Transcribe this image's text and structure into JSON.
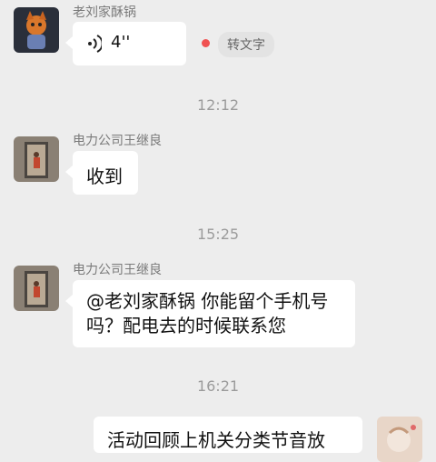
{
  "messages": [
    {
      "sender": "老刘家酥锅",
      "voice_duration": "4''",
      "convert_label": "转文字"
    },
    {
      "timestamp": "12:12",
      "sender": "电力公司王继良",
      "text": "收到"
    },
    {
      "timestamp": "15:25",
      "sender": "电力公司王继良",
      "text_line1": "@老刘家酥锅 你能留个手机号",
      "text_line2": "吗？配电去的时候联系您"
    },
    {
      "timestamp": "16:21",
      "text": "活动回顾上机关分类节音放"
    }
  ],
  "colors": {
    "background": "#ededed",
    "bubble": "#ffffff",
    "unread_dot": "#f05151",
    "meta_text": "#9b9b9b"
  },
  "icons": [
    "voice-wave-icon"
  ]
}
